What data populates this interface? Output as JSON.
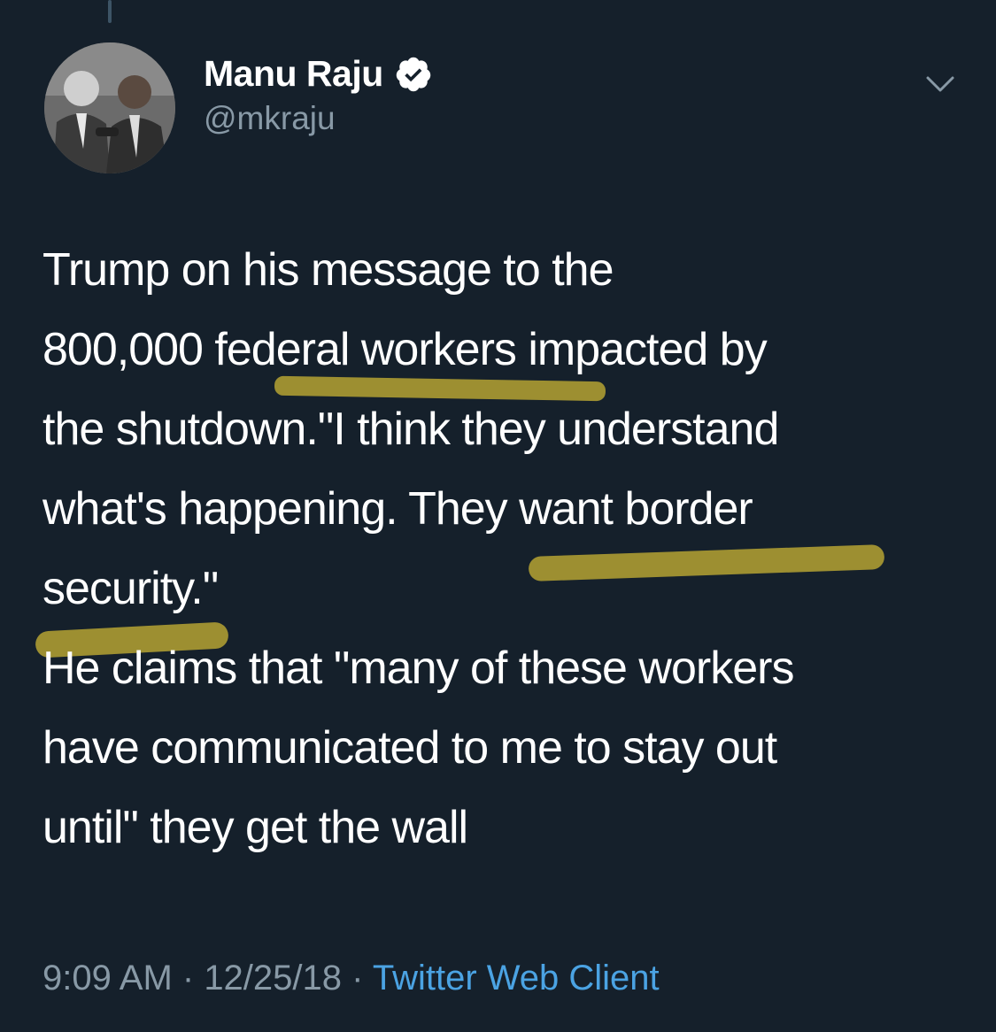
{
  "tweet": {
    "author": {
      "display_name": "Manu Raju",
      "handle": "@mkraju",
      "verified": true,
      "avatar_icon": "profile-photo"
    },
    "text_lines": [
      "Trump on his message to the",
      "800,000 federal workers impacted by",
      "the shutdown.\"I think they understand",
      "what's happening. They want border",
      "security.\"",
      "He claims that \"many of these workers",
      "have communicated to me to stay out",
      "until\" they get the wall"
    ],
    "highlighted_phrases": [
      "federal workers",
      "want border",
      "security"
    ],
    "meta": {
      "time": "9:09 AM",
      "separator": " · ",
      "date": "12/25/18",
      "source": "Twitter Web Client"
    },
    "menu_icon": "chevron-down-icon"
  },
  "colors": {
    "background": "#15202b",
    "text": "#ffffff",
    "muted": "#8899a6",
    "link": "#4ba3e3",
    "highlight": "#b5a332"
  }
}
